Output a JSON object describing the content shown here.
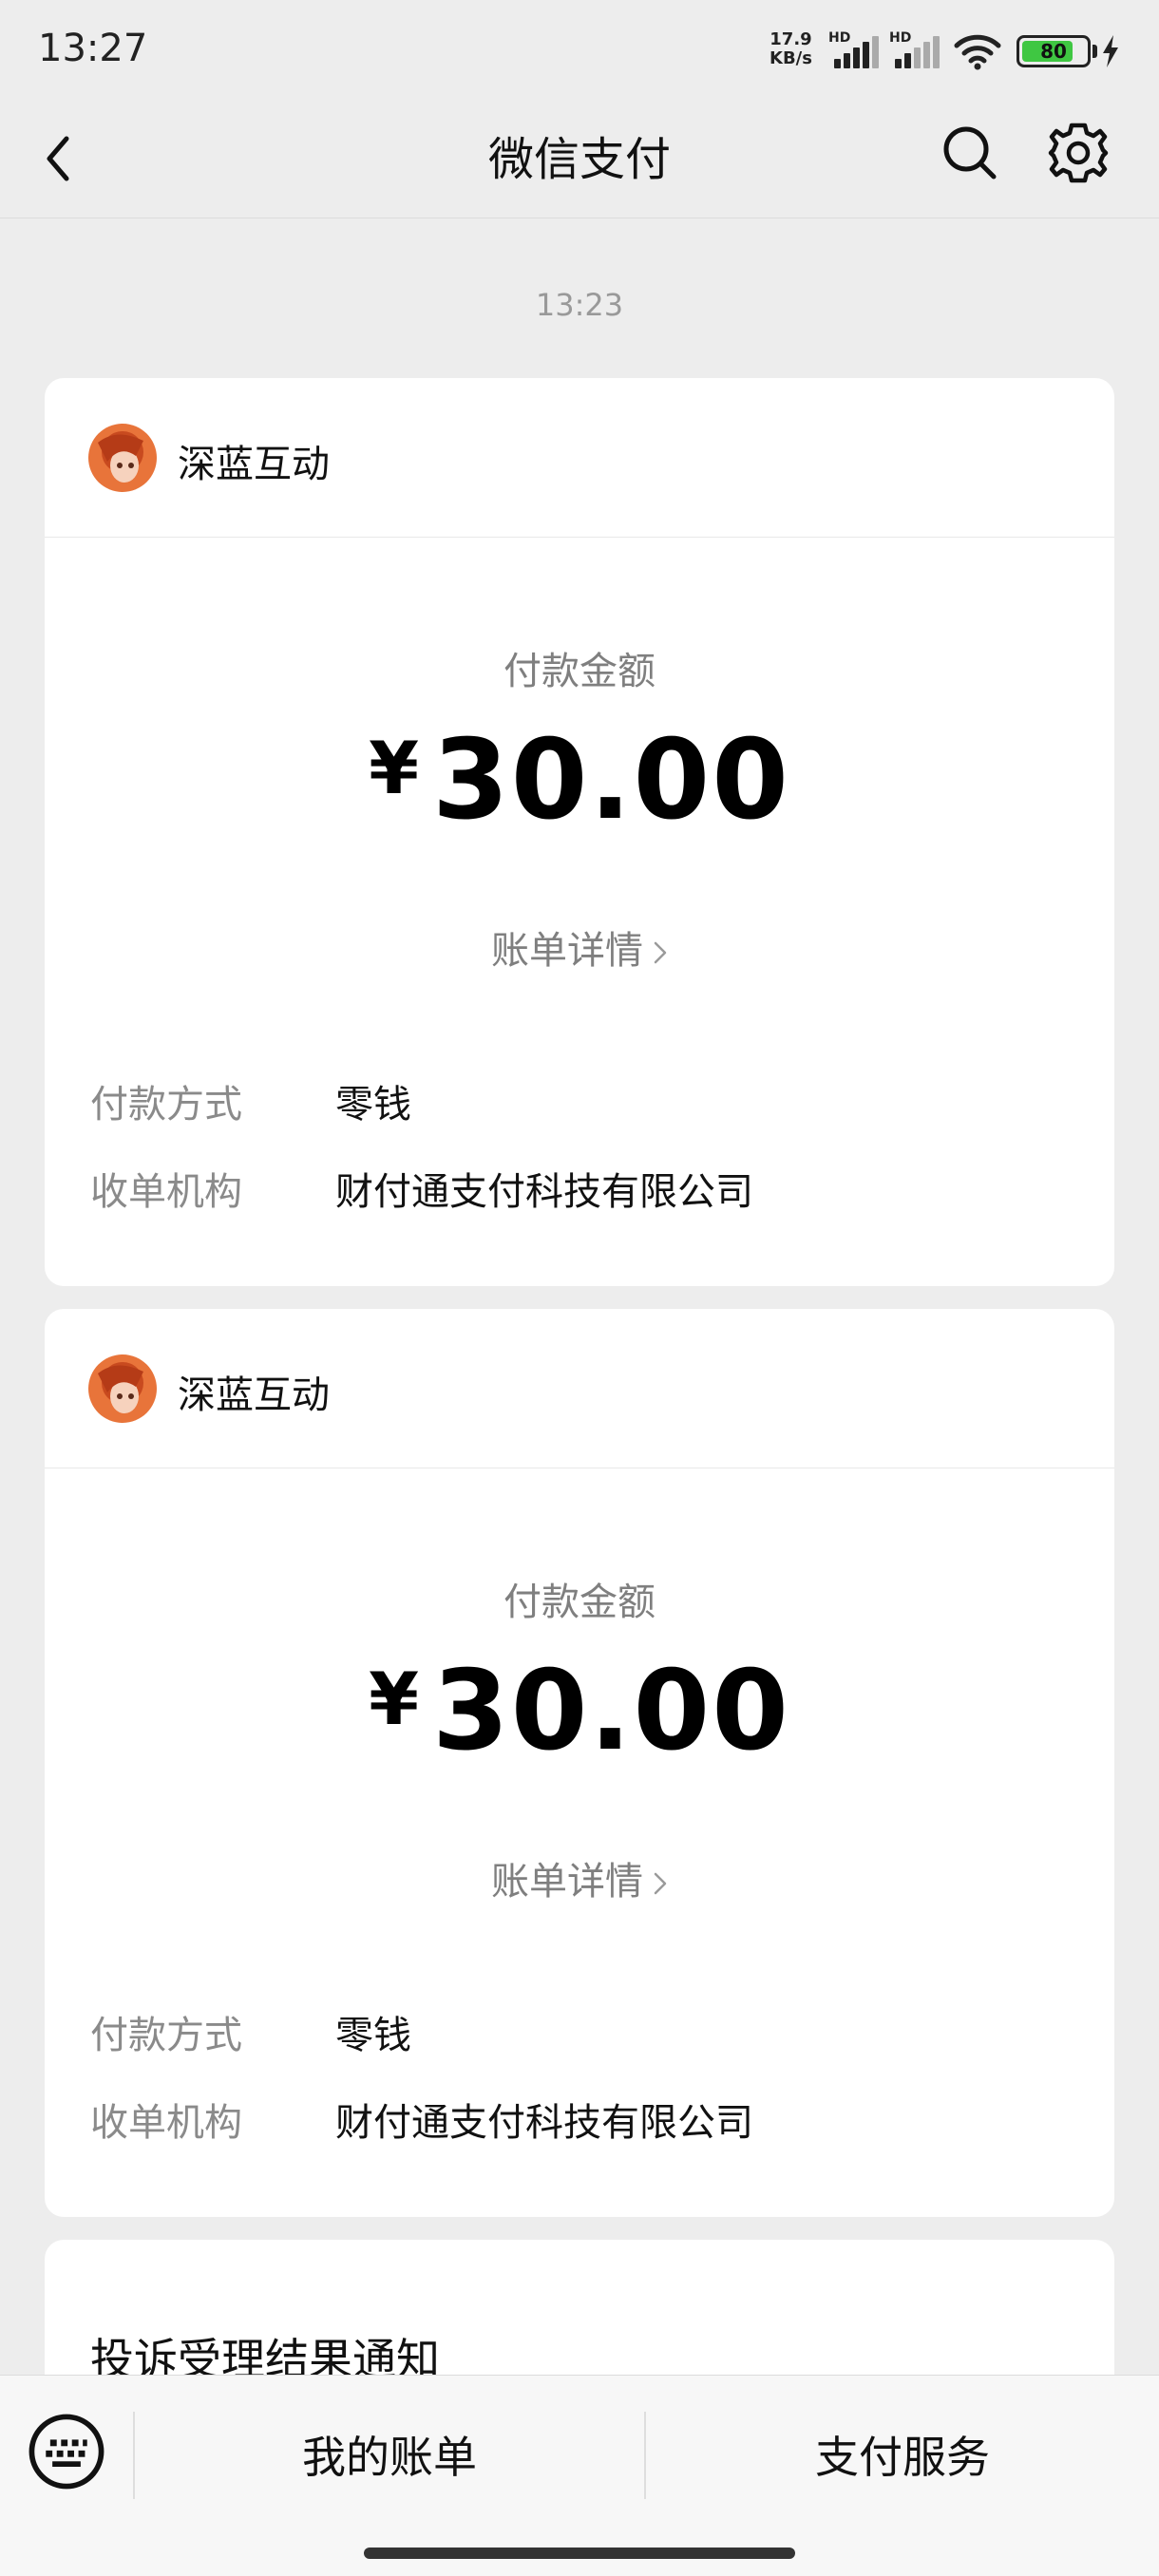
{
  "status_bar": {
    "time": "13:27",
    "net_speed_value": "17.9",
    "net_speed_unit": "KB/s",
    "signal1_label": "HD",
    "signal2_label": "HD",
    "battery_level": "80"
  },
  "nav": {
    "title": "微信支付",
    "icons": [
      "back-icon",
      "search-icon",
      "gear-icon"
    ]
  },
  "timestamp": "13:23",
  "payments": [
    {
      "merchant": "深蓝互动",
      "amount_label": "付款金额",
      "currency": "¥",
      "amount": "30.00",
      "detail_link": "账单详情",
      "method_label": "付款方式",
      "method_value": "零钱",
      "acquirer_label": "收单机构",
      "acquirer_value": "财付通支付科技有限公司"
    },
    {
      "merchant": "深蓝互动",
      "amount_label": "付款金额",
      "currency": "¥",
      "amount": "30.00",
      "detail_link": "账单详情",
      "method_label": "付款方式",
      "method_value": "零钱",
      "acquirer_label": "收单机构",
      "acquirer_value": "财付通支付科技有限公司"
    }
  ],
  "notice": {
    "title": "投诉受理结果通知"
  },
  "bottom_bar": {
    "my_bills": "我的账单",
    "pay_services": "支付服务"
  },
  "colors": {
    "background": "#ededed",
    "card": "#ffffff",
    "secondary_text": "#7f7f7f",
    "battery_green": "#3fc742"
  }
}
